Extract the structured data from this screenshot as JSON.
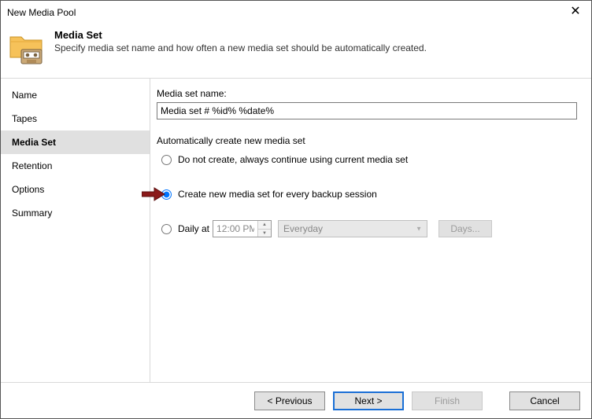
{
  "window": {
    "title": "New Media Pool"
  },
  "header": {
    "heading": "Media Set",
    "subtitle": "Specify media set name and how often a new media set should be automatically created."
  },
  "sidebar": {
    "items": [
      {
        "label": "Name"
      },
      {
        "label": "Tapes"
      },
      {
        "label": "Media Set"
      },
      {
        "label": "Retention"
      },
      {
        "label": "Options"
      },
      {
        "label": "Summary"
      }
    ],
    "active_index": 2
  },
  "form": {
    "name_label": "Media set name:",
    "name_value": "Media set # %id% %date%",
    "auto_label": "Automatically create new media set",
    "radios": {
      "do_not_create": "Do not create, always continue using current media set",
      "every_session": "Create new media set for every backup session",
      "daily_at": "Daily at"
    },
    "selected": "every_session",
    "time_value": "12:00 PM",
    "recurrence_value": "Everyday",
    "days_button": "Days..."
  },
  "footer": {
    "previous": "< Previous",
    "next": "Next >",
    "finish": "Finish",
    "cancel": "Cancel"
  }
}
